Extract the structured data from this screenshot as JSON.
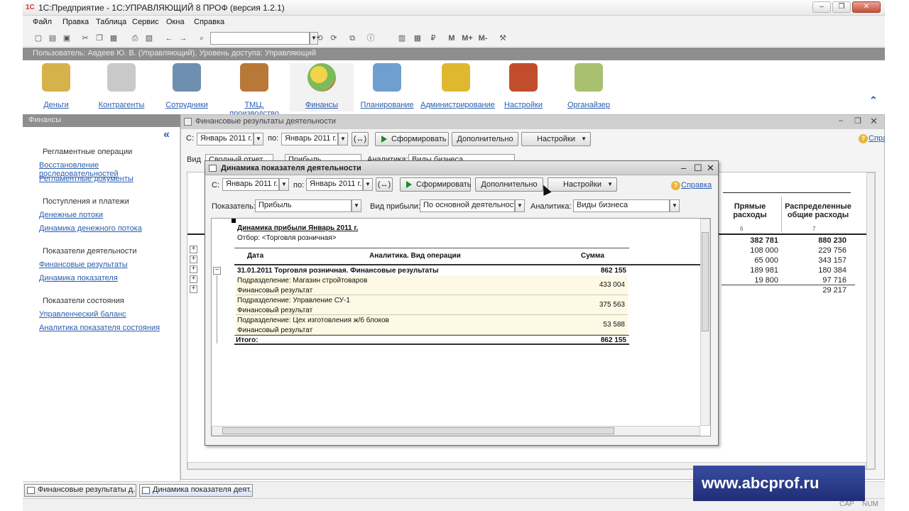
{
  "window": {
    "title": "1С:Предприятие - 1С:УПРАВЛЯЮЩИЙ 8 ПРОФ (версия 1.2.1)",
    "logo_text": "1С"
  },
  "menu": [
    "Файл",
    "Правка",
    "Таблица",
    "Сервис",
    "Окна",
    "Справка"
  ],
  "toolbar": {
    "search_value": "",
    "m_buttons": [
      "M",
      "M+",
      "M-"
    ]
  },
  "user_info": "Пользователь: Авдеев Ю. В. (Управляющий), Уровень доступа: Управляющий",
  "sections": [
    {
      "label": "Деньги",
      "icon": "money-icon",
      "color": "#d6b24a"
    },
    {
      "label": "Контрагенты",
      "icon": "truck-icon",
      "color": "#c9c9c9"
    },
    {
      "label": "Сотрудники",
      "icon": "employee-icon",
      "color": "#6f8fb0"
    },
    {
      "label": "ТМЦ, производство",
      "icon": "boxes-icon",
      "color": "#b87838"
    },
    {
      "label": "Финансы",
      "icon": "pie-chart-icon",
      "color": "#7cba5c"
    },
    {
      "label": "Планирование",
      "icon": "documents-icon",
      "color": "#6f9fd0"
    },
    {
      "label": "Администрирование",
      "icon": "database-icon",
      "color": "#e0b830"
    },
    {
      "label": "Настройки",
      "icon": "toolbox-icon",
      "color": "#c24d2c"
    },
    {
      "label": "Органайзер",
      "icon": "clipboard-icon",
      "color": "#a8c070"
    }
  ],
  "left_panel": {
    "title": "Финансы",
    "groups": [
      {
        "heading": "Регламентные операции",
        "links": [
          "Восстановление последовательностей",
          "Регламентные документы"
        ]
      },
      {
        "heading": "Поступления и платежи",
        "links": [
          "Денежные потоки",
          "Динамика денежного потока"
        ]
      },
      {
        "heading": "Показатели деятельности",
        "links": [
          "Финансовые результаты",
          "Динамика показателя"
        ]
      },
      {
        "heading": "Показатели состояния",
        "links": [
          "Управленческий баланс",
          "Аналитика показателя состояния"
        ]
      }
    ]
  },
  "main_window": {
    "title": "Финансовые результаты деятельности",
    "from_label": "С:",
    "from_value": "Январь 2011 г.",
    "to_label": "по:",
    "to_value": "Январь 2011 г.",
    "period_btn": "(↔)",
    "generate_btn": "Сформировать",
    "more_btn": "Дополнительно",
    "settings_btn": "Настройки",
    "help": "Справка",
    "view_label": "Вид",
    "view_value": "Сводный отчет",
    "profit_value": "Прибыль",
    "analytics_label": "Аналитика:",
    "analytics_value": "Виды бизнеса",
    "columns": [
      {
        "title": "Прямые\nрасходы",
        "num": "6"
      },
      {
        "title": "Распределенные\nобщие расходы",
        "num": "7"
      }
    ],
    "rows": [
      [
        "382 781",
        "880 230"
      ],
      [
        "108 000",
        "229 756"
      ],
      [
        "65 000",
        "343 157"
      ],
      [
        "189 981",
        "180 384"
      ],
      [
        "19 800",
        "97 716"
      ],
      [
        "",
        "29 217"
      ]
    ]
  },
  "dialog": {
    "title": "Динамика показателя деятельности",
    "from_label": "С:",
    "from_value": "Январь 2011 г.",
    "to_label": "по:",
    "to_value": "Январь 2011 г.",
    "period_btn": "(↔)",
    "generate_btn": "Сформировать",
    "more_btn": "Дополнительно",
    "settings_btn": "Настройки",
    "help": "Справка",
    "indicator_label": "Показатель:",
    "indicator_value": "Прибыль",
    "profit_type_label": "Вид прибыли:",
    "profit_type_value": "По основной деятельности",
    "analytics_label": "Аналитика:",
    "analytics_value": "Виды бизнеса",
    "report": {
      "title": "Динамика прибыли Январь 2011 г.",
      "filter": "Отбор: <Торговля розничная>",
      "col_date": "Дата",
      "col_analytics": "Аналитика. Вид операции",
      "col_sum": "Сумма",
      "group_row": {
        "label": "31.01.2011   Торговля розничная. Финансовые результаты",
        "sum": "862 155"
      },
      "detail_rows": [
        {
          "line1": "Подразделение:  Магазин стройтоваров",
          "line2": "Финансовый результат",
          "sum": "433 004"
        },
        {
          "line1": "Подразделение:  Управление СУ-1",
          "line2": "Финансовый результат",
          "sum": "375 563"
        },
        {
          "line1": "Подразделение:  Цех изготовления ж/б блоков",
          "line2": "Финансовый результат",
          "sum": "53 588"
        }
      ],
      "total_label": "Итого:",
      "total_sum": "862 155"
    }
  },
  "taskbar": [
    "Финансовые результаты д...",
    "Динамика показателя деят..."
  ],
  "status": {
    "cap": "CAP",
    "num": "NUM"
  },
  "watermark": "www.abcprof.ru"
}
